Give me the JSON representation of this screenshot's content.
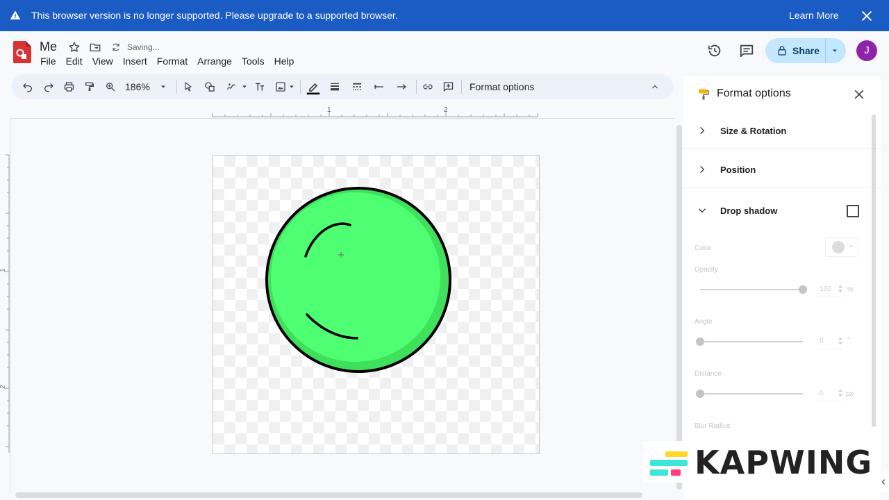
{
  "banner": {
    "message": "This browser version is no longer supported. Please upgrade to a supported browser.",
    "learn_more": "Learn More",
    "color": "#1a5bc4"
  },
  "header": {
    "title": "Me",
    "saving": "Saving...",
    "menus": [
      "File",
      "Edit",
      "View",
      "Insert",
      "Format",
      "Arrange",
      "Tools",
      "Help"
    ],
    "share_label": "Share",
    "avatar_letter": "J"
  },
  "toolbar": {
    "zoom": "186%",
    "format_options": "Format options"
  },
  "ruler": {
    "h_labels": [
      "1",
      "2"
    ],
    "v_labels": [
      "1",
      "2"
    ]
  },
  "panel": {
    "title": "Format options",
    "sections": {
      "size_rotation": "Size & Rotation",
      "position": "Position",
      "drop_shadow": "Drop shadow"
    },
    "labels": {
      "color": "Color",
      "opacity": "Opacity",
      "angle": "Angle",
      "distance": "Distance",
      "blur": "Blur Radius"
    },
    "values": {
      "opacity": "100",
      "angle": "0",
      "distance": "0"
    },
    "units": {
      "percent": "%",
      "degree": "°",
      "px": "px"
    }
  },
  "watermark": {
    "text": "KAPWING"
  }
}
